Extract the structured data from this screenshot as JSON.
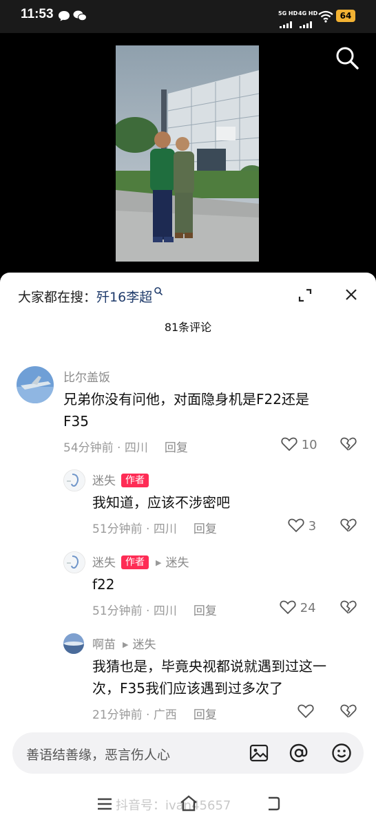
{
  "status_bar": {
    "time": "11:53",
    "net1": "5G HD",
    "net2": "4G HD",
    "battery": "64"
  },
  "search": {
    "prefix": "大家都在搜：",
    "term": "歼16李超"
  },
  "comments_count": "81条评论",
  "comments": [
    {
      "user": "比尔盖饭",
      "text_line1": "兄弟你没有问他，对面隐身机是F22还是",
      "text_line2": "F35",
      "meta": "54分钟前 · 四川",
      "reply": "回复",
      "likes": "10"
    },
    {
      "user": "迷失",
      "badge": "作者",
      "text": "我知道，应该不涉密吧",
      "meta": "51分钟前 · 四川",
      "reply": "回复",
      "likes": "3"
    },
    {
      "user": "迷失",
      "badge": "作者",
      "reply_to": "迷失",
      "text": "f22",
      "meta": "51分钟前 · 四川",
      "reply": "回复",
      "likes": "24"
    },
    {
      "user": "啊苗",
      "reply_to": "迷失",
      "text_line1": "我猜也是，毕竟央视都说就遇到过这一",
      "text_line2": "次，F35我们应该遇到过多次了",
      "meta": "21分钟前 · 广西",
      "reply": "回复",
      "likes": ""
    }
  ],
  "input": {
    "placeholder": "善语结善缘，恶言伤人心"
  },
  "watermark": "抖音号：ivan45657",
  "colors": {
    "badge": "#fe2c55",
    "link": "#1f3b6b",
    "battery": "#f2b233"
  }
}
